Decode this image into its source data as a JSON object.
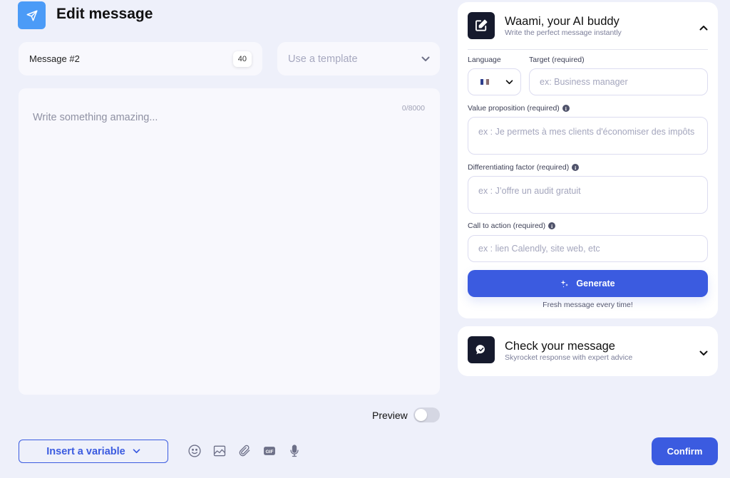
{
  "header": {
    "icon": "send-icon",
    "title": "Edit message"
  },
  "message": {
    "name": "Message #2",
    "name_length": "40",
    "template_placeholder": "Use a template",
    "body_placeholder": "Write something amazing...",
    "body_value": "",
    "char_counter": "0/8000"
  },
  "preview": {
    "label": "Preview",
    "enabled": false
  },
  "toolbar": {
    "insert_variable_label": "Insert a variable",
    "tools": [
      "emoji-icon",
      "image-icon",
      "attachment-icon",
      "gif-icon",
      "microphone-icon"
    ],
    "gif_text": "GIF",
    "confirm_label": "Confirm"
  },
  "colors": {
    "accent": "#3b5be0",
    "header_icon_bg": "#4b9bf7",
    "card_icon_bg": "#161a2d",
    "page_bg": "#eef0fa"
  },
  "waami": {
    "title": "Waami, your AI buddy",
    "subtitle": "Write the perfect message instantly",
    "expanded": true,
    "language_label": "Language",
    "language_value": "French",
    "target_label": "Target (required)",
    "target_placeholder": "ex: Business manager",
    "value_prop_label": "Value proposition (required)",
    "value_prop_placeholder": "ex : Je permets à mes clients d'économiser des impôts",
    "diff_label": "Differentiating factor (required)",
    "diff_placeholder": "ex : J’offre un audit gratuit",
    "cta_label": "Call to action (required)",
    "cta_placeholder": "ex : lien Calendly, site web, etc",
    "info_glyph": "i",
    "generate_label": "Generate",
    "fresh_text": "Fresh message every time!"
  },
  "check": {
    "title": "Check your message",
    "subtitle": "Skyrocket response with expert advice",
    "expanded": false
  }
}
